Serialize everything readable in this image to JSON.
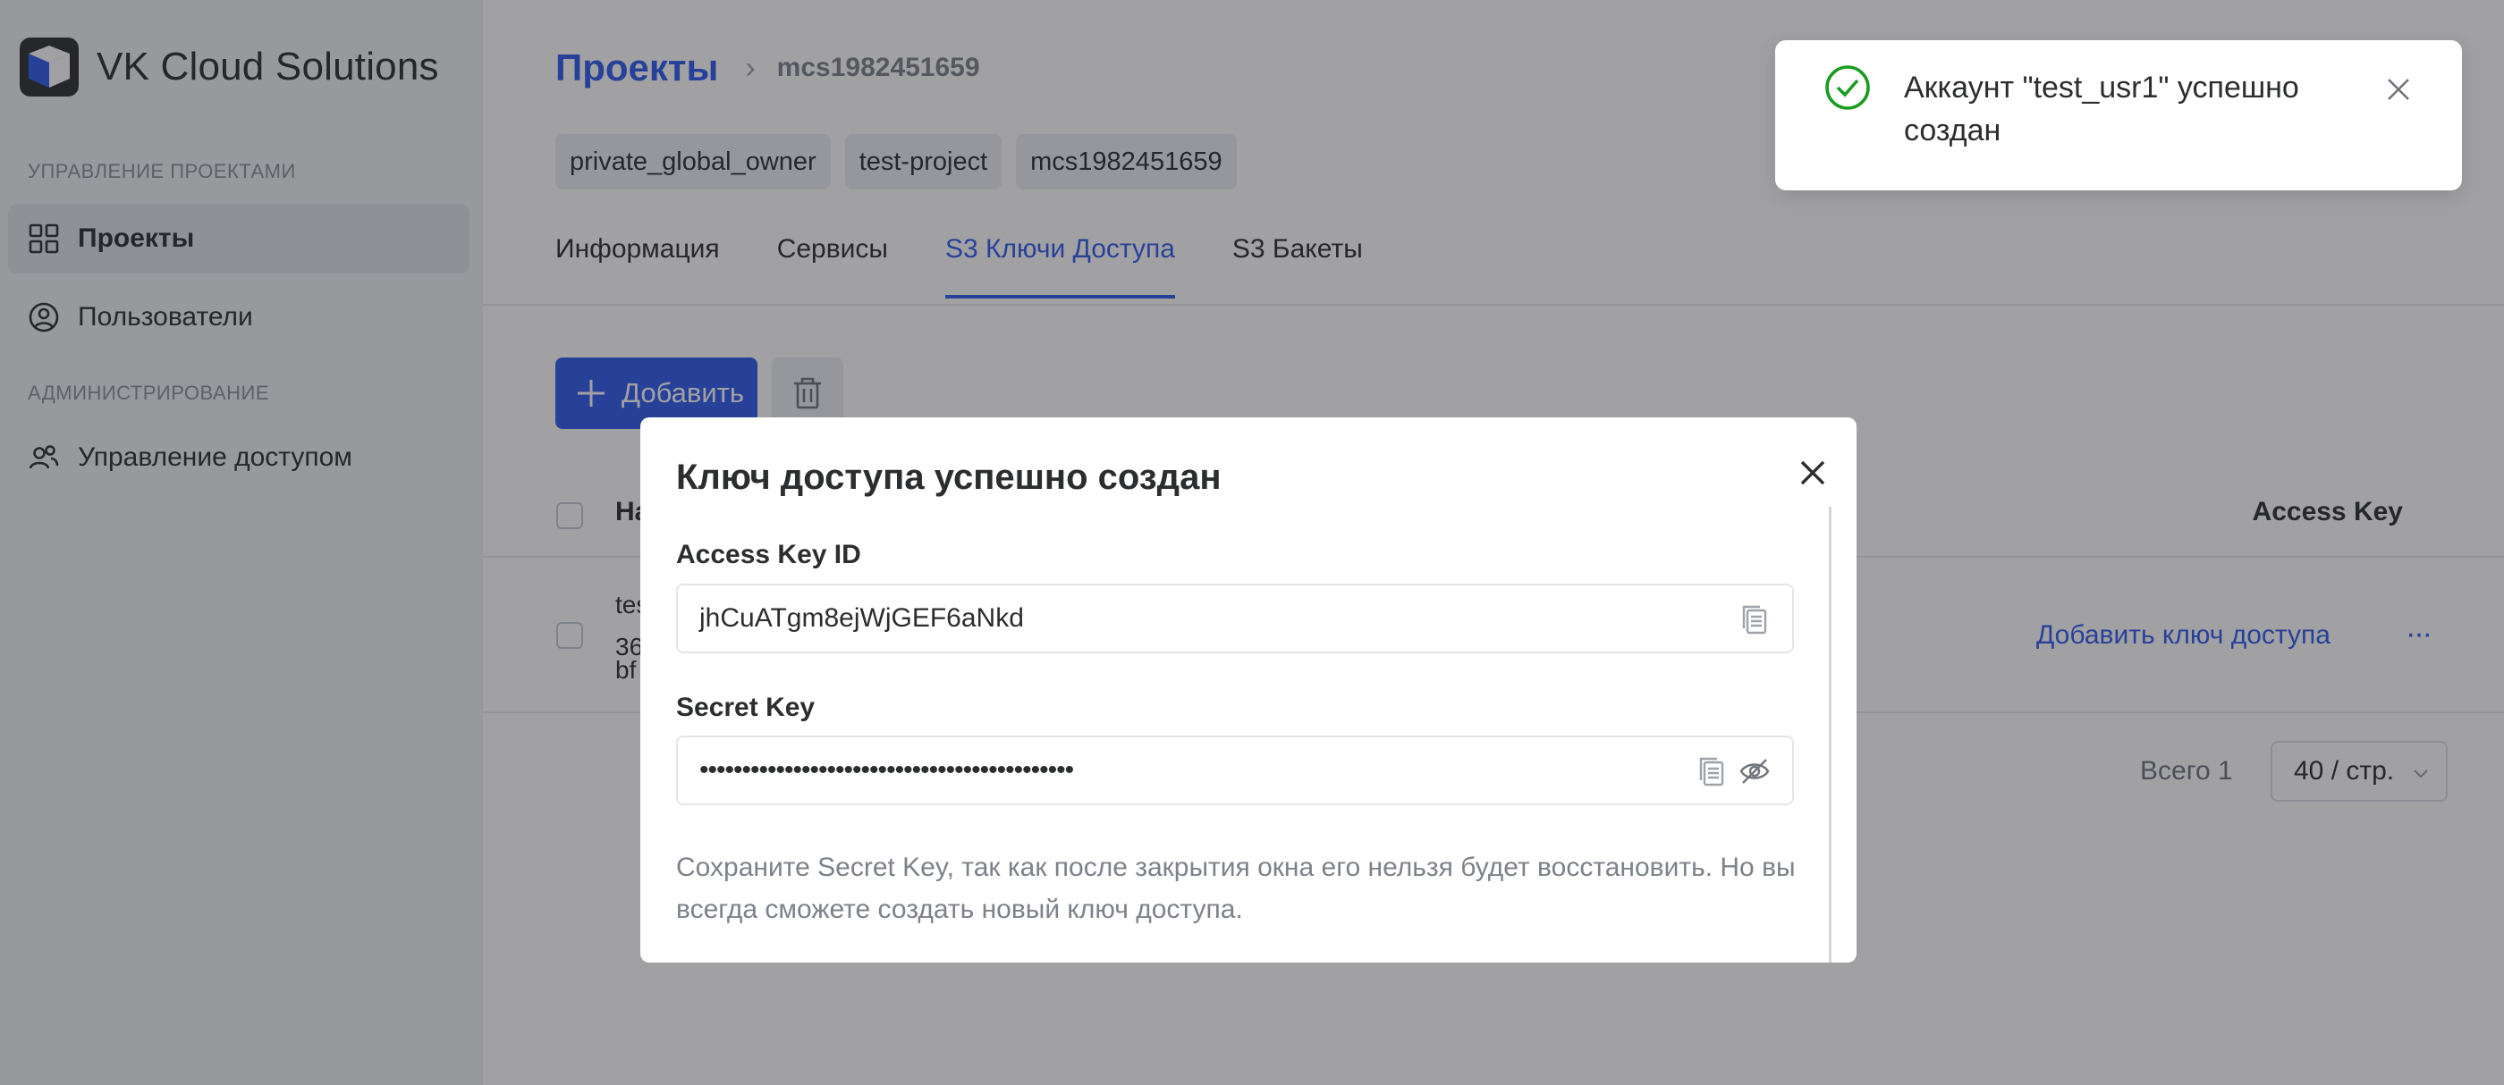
{
  "brand": {
    "name": "VK Cloud Solutions",
    "accent": "#2f5bea"
  },
  "sidebar": {
    "section_projects": "УПРАВЛЕНИЕ ПРОЕКТАМИ",
    "section_admin": "АДМИНИСТРИРОВАНИЕ",
    "items": [
      {
        "label": "Проекты",
        "icon": "grid-icon",
        "active": true
      },
      {
        "label": "Пользователи",
        "icon": "user-circle-icon",
        "active": false
      },
      {
        "label": "Управление доступом",
        "icon": "users-icon",
        "active": false
      }
    ]
  },
  "header": {
    "breadcrumb_root": "Проекты",
    "breadcrumb_separator": "›",
    "breadcrumb_current": "mcs1982451659",
    "tags": [
      "private_global_owner",
      "test-project",
      "mcs1982451659"
    ]
  },
  "tabs": [
    {
      "label": "Информация",
      "active": false
    },
    {
      "label": "Сервисы",
      "active": false
    },
    {
      "label": "S3 Ключи Доступа",
      "active": true
    },
    {
      "label": "S3 Бакеты",
      "active": false
    }
  ],
  "toolbar": {
    "add_label": "Добавить"
  },
  "table": {
    "col_name": "На",
    "col_access": "Access Key",
    "row": {
      "name_line1": "tes",
      "name_line2": "36",
      "name_line3": "bf",
      "action_label": "Добавить ключ доступа",
      "more_label": "···"
    }
  },
  "pagination": {
    "total": "Всего 1",
    "per_page": "40 / стр."
  },
  "modal": {
    "title": "Ключ доступа успешно создан",
    "access_key_label": "Access Key ID",
    "access_key_value": "jhCuATgm8ejWjGEF6aNkd",
    "secret_key_label": "Secret Key",
    "secret_key_value": "••••••••••••••••••••••••••••••••••••••••••••",
    "note": "Сохраните Secret Key, так как после закрытия окна его нельзя будет восстановить. Но вы всегда сможете создать новый ключ доступа."
  },
  "toast": {
    "message": "Аккаунт \"test_usr1\" успешно создан",
    "status": "success",
    "status_color": "#1a9c20"
  }
}
